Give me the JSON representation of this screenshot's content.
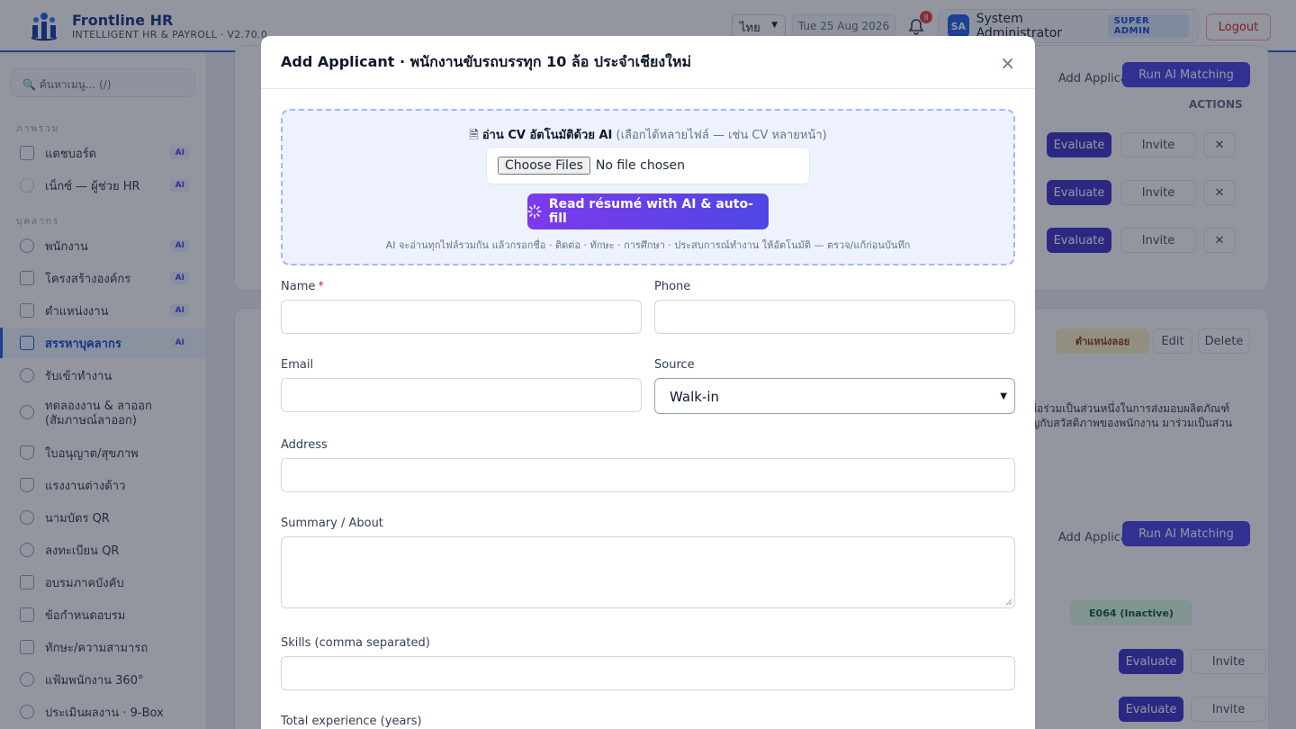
{
  "header": {
    "brand_name": "Frontline HR",
    "brand_sub": "INTELLIGENT HR & PAYROLL · V2.70.0",
    "lang": "ไทย",
    "date": "Tue 25 Aug 2026",
    "notif_count": "8",
    "avatar": "SA",
    "user_name": "System Administrator",
    "role": "SUPER ADMIN",
    "logout": "Logout"
  },
  "sidebar": {
    "search": "🔍 ค้นหาเมนู... (/)",
    "sections": [
      "ภาพรวม",
      "บุคลากร"
    ],
    "items": [
      {
        "label": "แดชบอร์ด",
        "badge": "AI",
        "icon": "grid-icon"
      },
      {
        "label": "เน็กซ์ — ผู้ช่วย HR",
        "badge": "AI",
        "icon": "sparkle-icon"
      },
      {
        "label": "พนักงาน",
        "badge": "AI",
        "icon": "users-icon"
      },
      {
        "label": "โครงสร้างองค์กร",
        "badge": "AI",
        "icon": "building-icon"
      },
      {
        "label": "ตำแหน่งงาน",
        "badge": "AI",
        "icon": "hierarchy-icon"
      },
      {
        "label": "สรรหาบุคลากร",
        "badge": "AI",
        "icon": "megaphone-icon"
      },
      {
        "label": "รับเข้าทำงาน",
        "badge": "",
        "icon": "compass-icon"
      },
      {
        "label": "ทดลองงาน & ลาออก (สัมภาษณ์ลาออก)",
        "badge": "",
        "icon": "compass-icon"
      },
      {
        "label": "ใบอนุญาต/สุขภาพ",
        "badge": "",
        "icon": "shield-icon"
      },
      {
        "label": "แรงงานต่างด้าว",
        "badge": "",
        "icon": "shield-icon"
      },
      {
        "label": "นามบัตร QR",
        "badge": "",
        "icon": "user-icon"
      },
      {
        "label": "ลงทะเบียน QR",
        "badge": "",
        "icon": "user-icon"
      },
      {
        "label": "อบรมภาคบังคับ",
        "badge": "",
        "icon": "cap-icon"
      },
      {
        "label": "ข้อกำหนดอบรม",
        "badge": "",
        "icon": "cap-icon"
      },
      {
        "label": "ทักษะ/ความสามารถ",
        "badge": "",
        "icon": "cap-icon"
      },
      {
        "label": "แฟ้มพนักงาน 360°",
        "badge": "",
        "icon": "user-icon"
      },
      {
        "label": "ประเมินผลงาน · 9-Box",
        "badge": "",
        "icon": "target-icon"
      }
    ]
  },
  "background": {
    "add_applicant": "Add Applicant",
    "run_ai": "Run AI Matching",
    "actions": "ACTIONS",
    "evaluate": "Evaluate",
    "invite": "Invite",
    "edit": "Edit",
    "delete": "Delete",
    "warn_tag": "ตำแหน่งลอย",
    "status_tag": "E064 (Inactive)",
    "desc_line1": "สูง เพื่อร่วมเป็นส่วนหนึ่งในการส่งมอบผลิตภัณฑ์",
    "desc_line2": "สำคัญกับสวัสดิภาพของพนักงาน มาร่วมเป็นส่วน"
  },
  "modal": {
    "title": "Add Applicant · พนักงานขับรถบรรทุก 10 ล้อ ประจำเชียงใหม่",
    "close": "×",
    "cv_heading": "อ่าน CV อัตโนมัติด้วย AI",
    "cv_note": "(เลือกได้หลายไฟล์ — เช่น CV หลายหน้า)",
    "choose_files": "Choose Files",
    "no_file": "No file chosen",
    "ai_button": "Read résumé with AI & auto-fill",
    "hint": "AI จะอ่านทุกไฟล์รวมกัน แล้วกรอกชื่อ · ติดต่อ · ทักษะ · การศึกษา · ประสบการณ์ทำงาน ให้อัตโนมัติ — ตรวจ/แก้ก่อนบันทึก",
    "name_label": "Name",
    "required_mark": "*",
    "phone_label": "Phone",
    "email_label": "Email",
    "source_label": "Source",
    "source_value": "Walk-in",
    "address_label": "Address",
    "summary_label": "Summary / About",
    "skills_label": "Skills (comma separated)",
    "experience_label": "Total experience (years)"
  }
}
